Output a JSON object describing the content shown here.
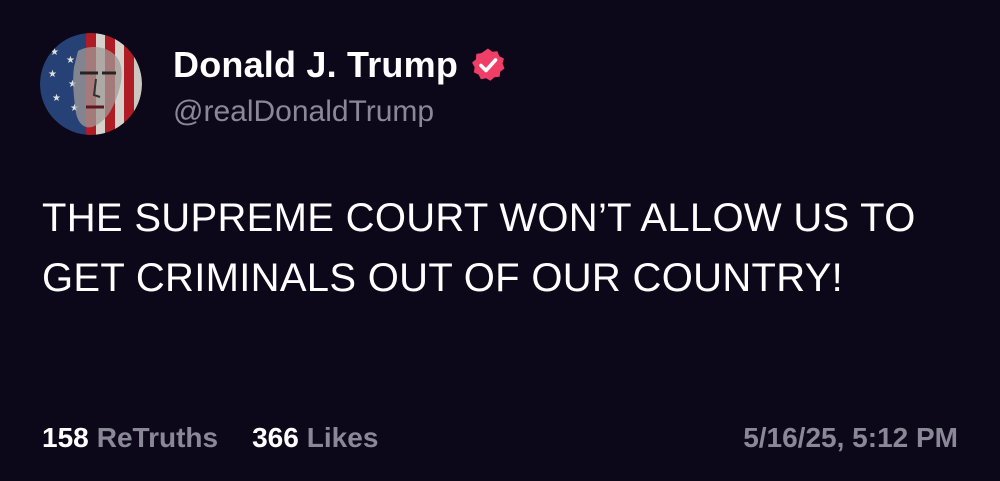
{
  "author": {
    "display_name": "Donald J. Trump",
    "handle": "@realDonaldTrump",
    "verified": true,
    "avatar_icon": "flag-portrait-avatar",
    "verified_icon": "verified-badge-icon"
  },
  "post": {
    "text": "THE SUPREME COURT WON’T ALLOW US TO GET CRIMINALS OUT OF OUR COUNTRY!"
  },
  "stats": {
    "retruths_count": "158",
    "retruths_label": "ReTruths",
    "likes_count": "366",
    "likes_label": "Likes",
    "timestamp": "5/16/25, 5:12 PM"
  },
  "colors": {
    "background": "#0c0819",
    "text": "#ffffff",
    "muted": "#8a8896",
    "verified_badge": "#ef3f68"
  }
}
